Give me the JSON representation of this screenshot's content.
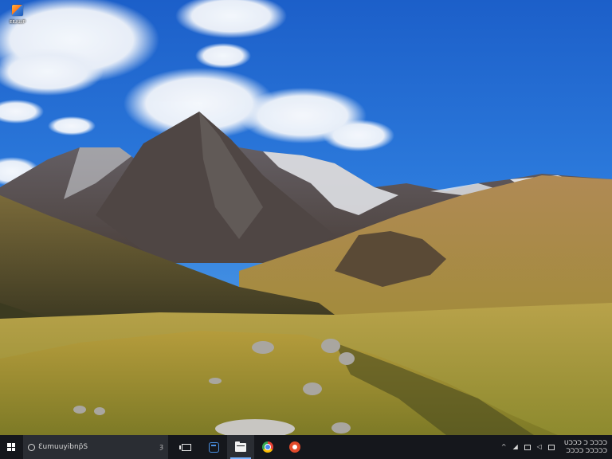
{
  "desktop": {
    "icon": {
      "label": "ᴇᴇᴊᴜᴊᴘ",
      "icon_name": "app-shortcut-icon"
    }
  },
  "taskbar": {
    "search": {
      "placeholder": "Ɛumuuyibnp̄S",
      "mic": "ȝ"
    },
    "apps": [
      {
        "name": "task-view-icon"
      },
      {
        "name": "edge-icon"
      },
      {
        "name": "file-explorer-icon",
        "active": true
      },
      {
        "name": "chrome-icon"
      },
      {
        "name": "app-red-icon"
      }
    ],
    "tray": {
      "chevron": "^",
      "clock_line1": "ᑌᑐᑐᑐ ᑐ ᑐᑐᑐᑐ",
      "clock_line2": "ᑐᑐᑐᑐ ᑐᑐᑐᑐᑐ"
    }
  },
  "colors": {
    "taskbar": "#15171c",
    "search_bg": "#2a2d33",
    "accent": "#7ab3ff"
  }
}
